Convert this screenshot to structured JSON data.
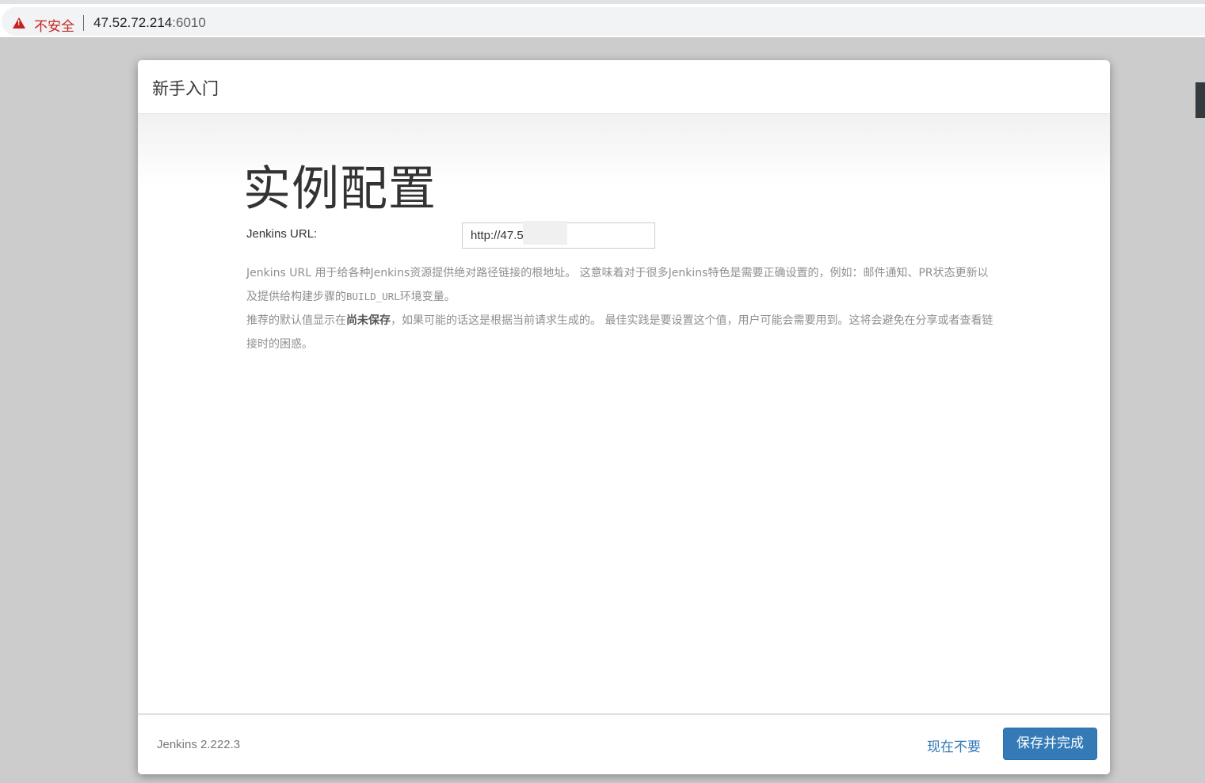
{
  "browser": {
    "security_label": "不安全",
    "url_host": "47.52.72.214",
    "url_port": ":6010"
  },
  "dialog": {
    "title": "新手入门",
    "heading": "实例配置",
    "url_field": {
      "label": "Jenkins URL:",
      "value": "http://47.5          :6010/"
    },
    "help": {
      "p1_part1": "Jenkins URL 用于给各种Jenkins资源提供绝对路径链接的根地址。 这意味着对于很多Jenkins特色是需要正确设置的，例如：邮件通知、PR状态更新以及提供给构建步骤的",
      "p1_code": "BUILD_URL",
      "p1_part2": "环境变量。",
      "p2_part1": "推荐的默认值显示在",
      "p2_strong": "尚未保存",
      "p2_part2": "，如果可能的话这是根据当前请求生成的。 最佳实践是要设置这个值，用户可能会需要用到。这将会避免在分享或者查看链接时的困惑。"
    },
    "footer": {
      "version": "Jenkins 2.222.3",
      "skip_label": "现在不要",
      "save_label": "保存并完成"
    }
  },
  "colors": {
    "accent": "#337ab7",
    "warning": "#c5221f"
  }
}
